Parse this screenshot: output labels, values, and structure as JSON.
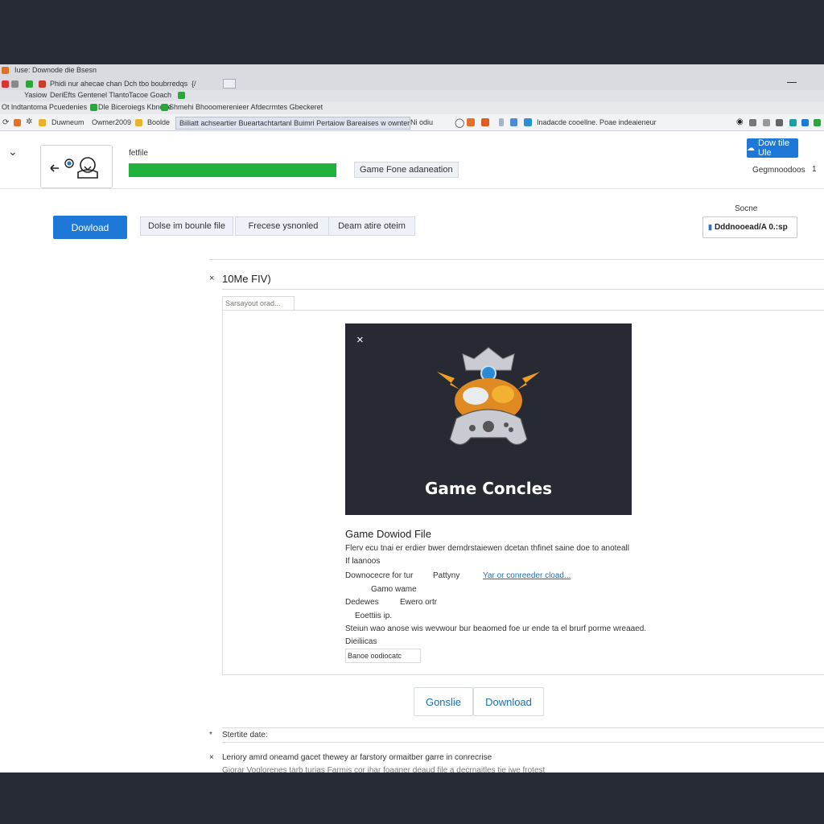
{
  "browser": {
    "title": "Iuse: Downode die Bsesn",
    "row2_text": "Phidi nur ahecae chan Dch tbo boubrredqs",
    "row2_num": "{/",
    "row3_items": [
      "Yasiow",
      "DeriEfts Gentenel Tlanto",
      "Tacoe Goach"
    ],
    "bookmarks": [
      "Ot lndtantoma Pcuedenies",
      "Dle Biceroiegs Kbnoge",
      "Shmehi Bhooomerenieer Afdecrmtes Gbeckeret"
    ],
    "tabs": [
      "Duwneum",
      "Owmer2009",
      "Boolde"
    ],
    "url": "Biiliatt achseartier Bueartachtartanl Buimri Pertaiow Bareaises w ownter",
    "page_label": "Ni odiu",
    "ext_text": "Inadacde cooellne. Poae indeaieneur"
  },
  "header": {
    "progress_label": "fetfile",
    "progress_value": 1.0,
    "status_chip": "Game Fone adaneation",
    "top_button": "Dow tile Ule",
    "downloads_label": "Gegmnoodoos",
    "downloads_count": "1"
  },
  "toolbar": {
    "download_button": "Dowload",
    "tabs": [
      "Dolse im bounle file",
      "Frecese ysnonled",
      "Deam atire oteim"
    ],
    "source_label": "Socne",
    "source_box": "Dddnooead/A 0.:sp"
  },
  "section": {
    "close_glyph": "×",
    "title": "10Me FIV)",
    "search_placeholder": "Sarsayout orad..."
  },
  "dialog": {
    "close_glyph": "×",
    "hero_title": "Game Concles",
    "heading": "Game Dowiod File",
    "desc": "Flerv ecu tnai er erdier bwer demdrstaiewen dcetan thfinet saine doe to anoteall",
    "sub1": "If laanoos",
    "label1": "Downocecre for tur",
    "value1": "Pattyny",
    "link1": "Yar or conreeder cload...",
    "value2": "Gamo wame",
    "label3": "Dedewes",
    "value3": "Ewero ortr",
    "value4": "Eoettiis ip.",
    "long_line": "Steiun wao anose wis wevwour bur beaomed foe ur ende ta el brurf porme wreaaed.",
    "label5": "Dieiliicas",
    "input_value": "Banoe oodiocatc",
    "btn_secondary": "Gonslie",
    "btn_primary": "Download"
  },
  "footer": {
    "marker1": "*",
    "label1": "Stertite date:",
    "marker2": "×",
    "line1": "Leriory amrd oneamd gacet thewey ar farstory ormaitber garre in conrecrise",
    "line2": "Giorar Voglorenes tarb turias Farmis cor ihar foaaner deaud file a decrnaitles tie iwe frotest"
  },
  "colors": {
    "backdrop": "#262b36",
    "accent": "#1e78d7",
    "progress": "#1fb13c",
    "hero_bg": "#272a33",
    "link": "#1b6fb3"
  }
}
